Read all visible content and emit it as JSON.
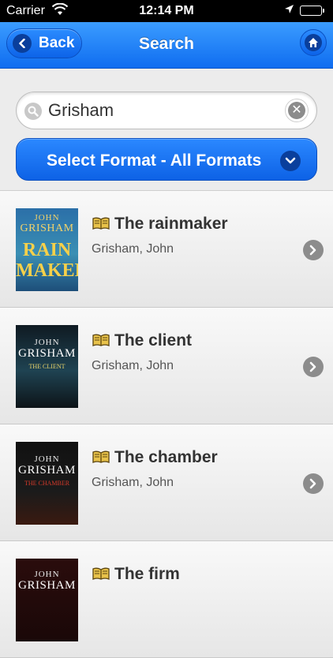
{
  "status_bar": {
    "carrier": "Carrier",
    "time": "12:14 PM"
  },
  "nav": {
    "back_label": "Back",
    "title": "Search"
  },
  "search": {
    "value": "Grisham",
    "placeholder": ""
  },
  "format": {
    "label": "Select Format - All Formats"
  },
  "results": [
    {
      "title": "The rainmaker",
      "author": "Grisham, John",
      "cover": {
        "line1": "JOHN",
        "line2": "GRISHAM",
        "big": "RAIN MAKER",
        "small": ""
      }
    },
    {
      "title": "The client",
      "author": "Grisham, John",
      "cover": {
        "line1": "JOHN",
        "line2": "GRISHAM",
        "big": "",
        "small": "THE CLIENT"
      }
    },
    {
      "title": "The chamber",
      "author": "Grisham, John",
      "cover": {
        "line1": "JOHN",
        "line2": "GRISHAM",
        "big": "",
        "small": "THE CHAMBER"
      }
    },
    {
      "title": "The firm",
      "author": "",
      "cover": {
        "line1": "JOHN",
        "line2": "GRISHAM",
        "big": "",
        "small": ""
      }
    }
  ],
  "colors": {
    "nav_blue": "#1a7cf5",
    "button_blue": "#0d62e6"
  }
}
